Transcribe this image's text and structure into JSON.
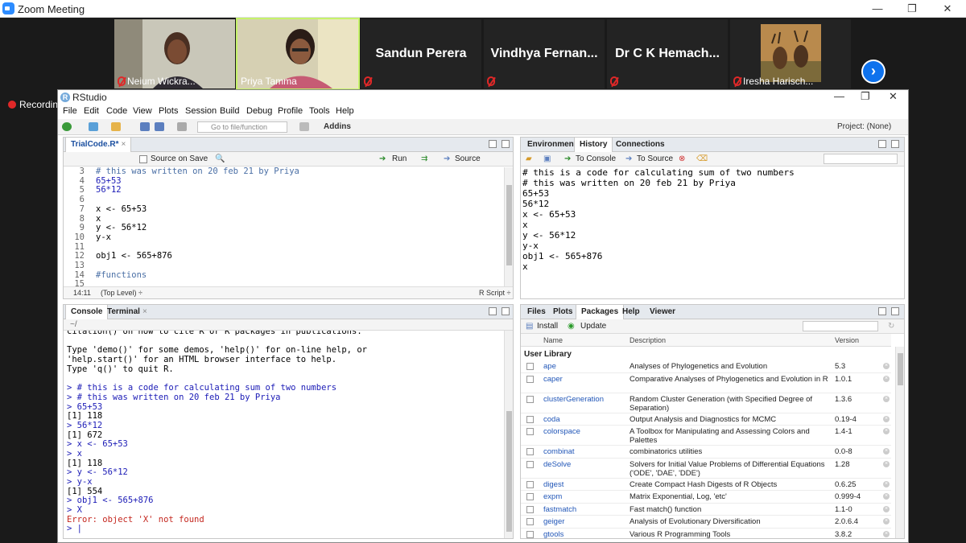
{
  "zoom": {
    "window_title": "Zoom Meeting",
    "recording_label": "Recording",
    "participants": [
      {
        "name": "Neium Wickra..."
      },
      {
        "name": "Priya Tamma"
      },
      {
        "name": "Sandun Perera"
      },
      {
        "name": "Vindhya Fernan..."
      },
      {
        "name": "Dr C K Hemach..."
      },
      {
        "name": "Iresha Harisch..."
      }
    ],
    "next_label": "›"
  },
  "rstudio": {
    "window_title": "RStudio",
    "menu": [
      "File",
      "Edit",
      "Code",
      "View",
      "Plots",
      "Session",
      "Build",
      "Debug",
      "Profile",
      "Tools",
      "Help"
    ],
    "toolbar": {
      "goto_placeholder": "Go to file/function",
      "addins": "Addins",
      "project": "Project: (None)"
    },
    "editor": {
      "tab": "TrialCode.R*",
      "source_on_save": "Source on Save",
      "run": "Run",
      "source": "Source",
      "lines": [
        {
          "n": "3",
          "t": "# this was written on 20 feb 21 by Priya",
          "k": "cmt"
        },
        {
          "n": "4",
          "t": "65+53",
          "k": "num"
        },
        {
          "n": "5",
          "t": "56*12",
          "k": "num"
        },
        {
          "n": "6",
          "t": "",
          "k": ""
        },
        {
          "n": "7",
          "t": "x <- 65+53",
          "k": ""
        },
        {
          "n": "8",
          "t": "x",
          "k": ""
        },
        {
          "n": "9",
          "t": "y <- 56*12",
          "k": ""
        },
        {
          "n": "10",
          "t": "y-x",
          "k": ""
        },
        {
          "n": "11",
          "t": "",
          "k": ""
        },
        {
          "n": "12",
          "t": "obj1 <- 565+876",
          "k": ""
        },
        {
          "n": "13",
          "t": "",
          "k": ""
        },
        {
          "n": "14",
          "t": "#functions",
          "k": "cmt"
        },
        {
          "n": "15",
          "t": "",
          "k": ""
        }
      ],
      "status_pos": "14:11",
      "status_scope": "(Top Level) ÷",
      "status_type": "R Script ÷"
    },
    "env": {
      "tabs": [
        "Environment",
        "History",
        "Connections"
      ],
      "to_console": "To Console",
      "to_source": "To Source",
      "history": [
        "# this is a code for calculating sum of two numbers",
        "# this was written on 20 feb 21 by Priya",
        "65+53",
        "56*12",
        "x <- 65+53",
        "x",
        "y <- 56*12",
        "y-x",
        "obj1 <- 565+876",
        "x"
      ]
    },
    "console": {
      "tabs": [
        "Console",
        "Terminal"
      ],
      "path": "~/",
      "lines": [
        {
          "t": "citation() on how to cite R or R packages in publications.",
          "k": ""
        },
        {
          "t": "",
          "k": ""
        },
        {
          "t": "Type 'demo()' for some demos, 'help()' for on-line help, or",
          "k": ""
        },
        {
          "t": "'help.start()' for an HTML browser interface to help.",
          "k": ""
        },
        {
          "t": "Type 'q()' to quit R.",
          "k": ""
        },
        {
          "t": "",
          "k": ""
        },
        {
          "t": "> # this is a code for calculating sum of two numbers",
          "k": "prm"
        },
        {
          "t": "> # this was written on 20 feb 21 by Priya",
          "k": "prm"
        },
        {
          "t": "> 65+53",
          "k": "prm"
        },
        {
          "t": "[1] 118",
          "k": ""
        },
        {
          "t": "> 56*12",
          "k": "prm"
        },
        {
          "t": "[1] 672",
          "k": ""
        },
        {
          "t": "> x <- 65+53",
          "k": "prm"
        },
        {
          "t": "> x",
          "k": "prm"
        },
        {
          "t": "[1] 118",
          "k": ""
        },
        {
          "t": "> y <- 56*12",
          "k": "prm"
        },
        {
          "t": "> y-x",
          "k": "prm"
        },
        {
          "t": "[1] 554",
          "k": ""
        },
        {
          "t": "> obj1 <- 565+876",
          "k": "prm"
        },
        {
          "t": "> X",
          "k": "prm"
        },
        {
          "t": "Error: object 'X' not found",
          "k": "err"
        },
        {
          "t": "> |",
          "k": "prm"
        }
      ]
    },
    "packages": {
      "tabs": [
        "Files",
        "Plots",
        "Packages",
        "Help",
        "Viewer"
      ],
      "install": "Install",
      "update": "Update",
      "col_name": "Name",
      "col_desc": "Description",
      "col_ver": "Version",
      "section": "User Library",
      "rows": [
        {
          "name": "ape",
          "desc": "Analyses of Phylogenetics and Evolution",
          "ver": "5.3"
        },
        {
          "name": "caper",
          "desc": "Comparative Analyses of Phylogenetics and Evolution in R",
          "ver": "1.0.1"
        },
        {
          "name": "clusterGeneration",
          "desc": "Random Cluster Generation (with Specified Degree of Separation)",
          "ver": "1.3.6"
        },
        {
          "name": "coda",
          "desc": "Output Analysis and Diagnostics for MCMC",
          "ver": "0.19-4"
        },
        {
          "name": "colorspace",
          "desc": "A Toolbox for Manipulating and Assessing Colors and Palettes",
          "ver": "1.4-1"
        },
        {
          "name": "combinat",
          "desc": "combinatorics utilities",
          "ver": "0.0-8"
        },
        {
          "name": "deSolve",
          "desc": "Solvers for Initial Value Problems of Differential Equations ('ODE', 'DAE', 'DDE')",
          "ver": "1.28"
        },
        {
          "name": "digest",
          "desc": "Create Compact Hash Digests of R Objects",
          "ver": "0.6.25"
        },
        {
          "name": "expm",
          "desc": "Matrix Exponential, Log, 'etc'",
          "ver": "0.999-4"
        },
        {
          "name": "fastmatch",
          "desc": "Fast match() function",
          "ver": "1.1-0"
        },
        {
          "name": "geiger",
          "desc": "Analysis of Evolutionary Diversification",
          "ver": "2.0.6.4"
        },
        {
          "name": "gtools",
          "desc": "Various R Programming Tools",
          "ver": "3.8.2"
        }
      ]
    }
  }
}
